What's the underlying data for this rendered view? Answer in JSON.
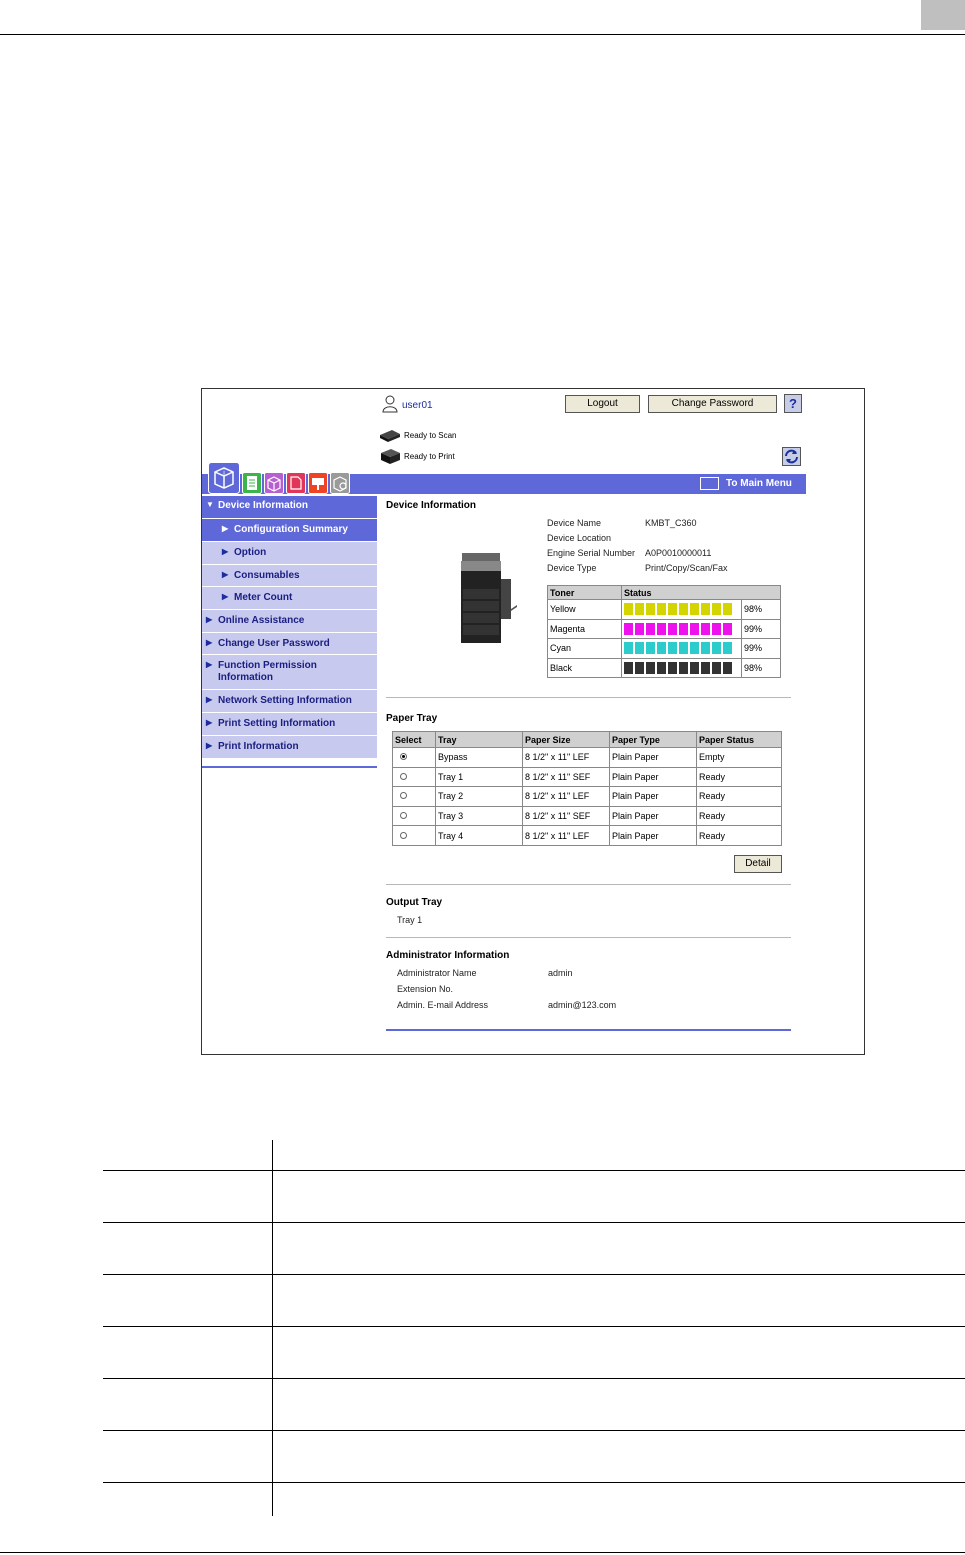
{
  "header": {
    "user": "user01",
    "logout_label": "Logout",
    "change_password_label": "Change Password",
    "help_label": "?"
  },
  "status": {
    "scan": "Ready to Scan",
    "print": "Ready to Print"
  },
  "menu": {
    "main_menu": "To Main Menu"
  },
  "sidebar": {
    "items": [
      "Device Information",
      "Configuration Summary",
      "Option",
      "Consumables",
      "Meter Count",
      "Online Assistance",
      "Change User Password",
      "Function Permission Information",
      "Network Setting Information",
      "Print Setting Information",
      "Print Information"
    ]
  },
  "device": {
    "title": "Device Information",
    "fields": [
      {
        "label": "Device Name",
        "value": "KMBT_C360"
      },
      {
        "label": "Device Location",
        "value": ""
      },
      {
        "label": "Engine Serial Number",
        "value": "A0P0010000011"
      },
      {
        "label": "Device Type",
        "value": "Print/Copy/Scan/Fax"
      }
    ],
    "toner_header": [
      "Toner",
      "Status"
    ],
    "toner": [
      {
        "name": "Yellow",
        "pct": "98%",
        "level": 98,
        "color": "#d4d400"
      },
      {
        "name": "Magenta",
        "pct": "99%",
        "level": 99,
        "color": "#ee11ee"
      },
      {
        "name": "Cyan",
        "pct": "99%",
        "level": 99,
        "color": "#2ccccc"
      },
      {
        "name": "Black",
        "pct": "98%",
        "level": 98,
        "color": "#333333"
      }
    ]
  },
  "paper_tray": {
    "title": "Paper Tray",
    "headers": [
      "Select",
      "Tray",
      "Paper Size",
      "Paper Type",
      "Paper Status"
    ],
    "rows": [
      {
        "selected": true,
        "tray": "Bypass",
        "size": "8 1/2\" x 11\" LEF",
        "type": "Plain Paper",
        "status": "Empty"
      },
      {
        "selected": false,
        "tray": "Tray 1",
        "size": "8 1/2\" x 11\" SEF",
        "type": "Plain Paper",
        "status": "Ready"
      },
      {
        "selected": false,
        "tray": "Tray 2",
        "size": "8 1/2\" x 11\" LEF",
        "type": "Plain Paper",
        "status": "Ready"
      },
      {
        "selected": false,
        "tray": "Tray 3",
        "size": "8 1/2\" x 11\" SEF",
        "type": "Plain Paper",
        "status": "Ready"
      },
      {
        "selected": false,
        "tray": "Tray 4",
        "size": "8 1/2\" x 11\" LEF",
        "type": "Plain Paper",
        "status": "Ready"
      }
    ],
    "detail_label": "Detail"
  },
  "output_tray": {
    "title": "Output Tray",
    "value": "Tray 1"
  },
  "admin": {
    "title": "Administrator Information",
    "fields": [
      {
        "label": "Administrator Name",
        "value": "admin"
      },
      {
        "label": "Extension No.",
        "value": ""
      },
      {
        "label": "Admin. E-mail Address",
        "value": "admin@123.com"
      }
    ]
  },
  "colors": {
    "accent": "#5f68d9",
    "nav_bg": "#c7c9ef"
  }
}
